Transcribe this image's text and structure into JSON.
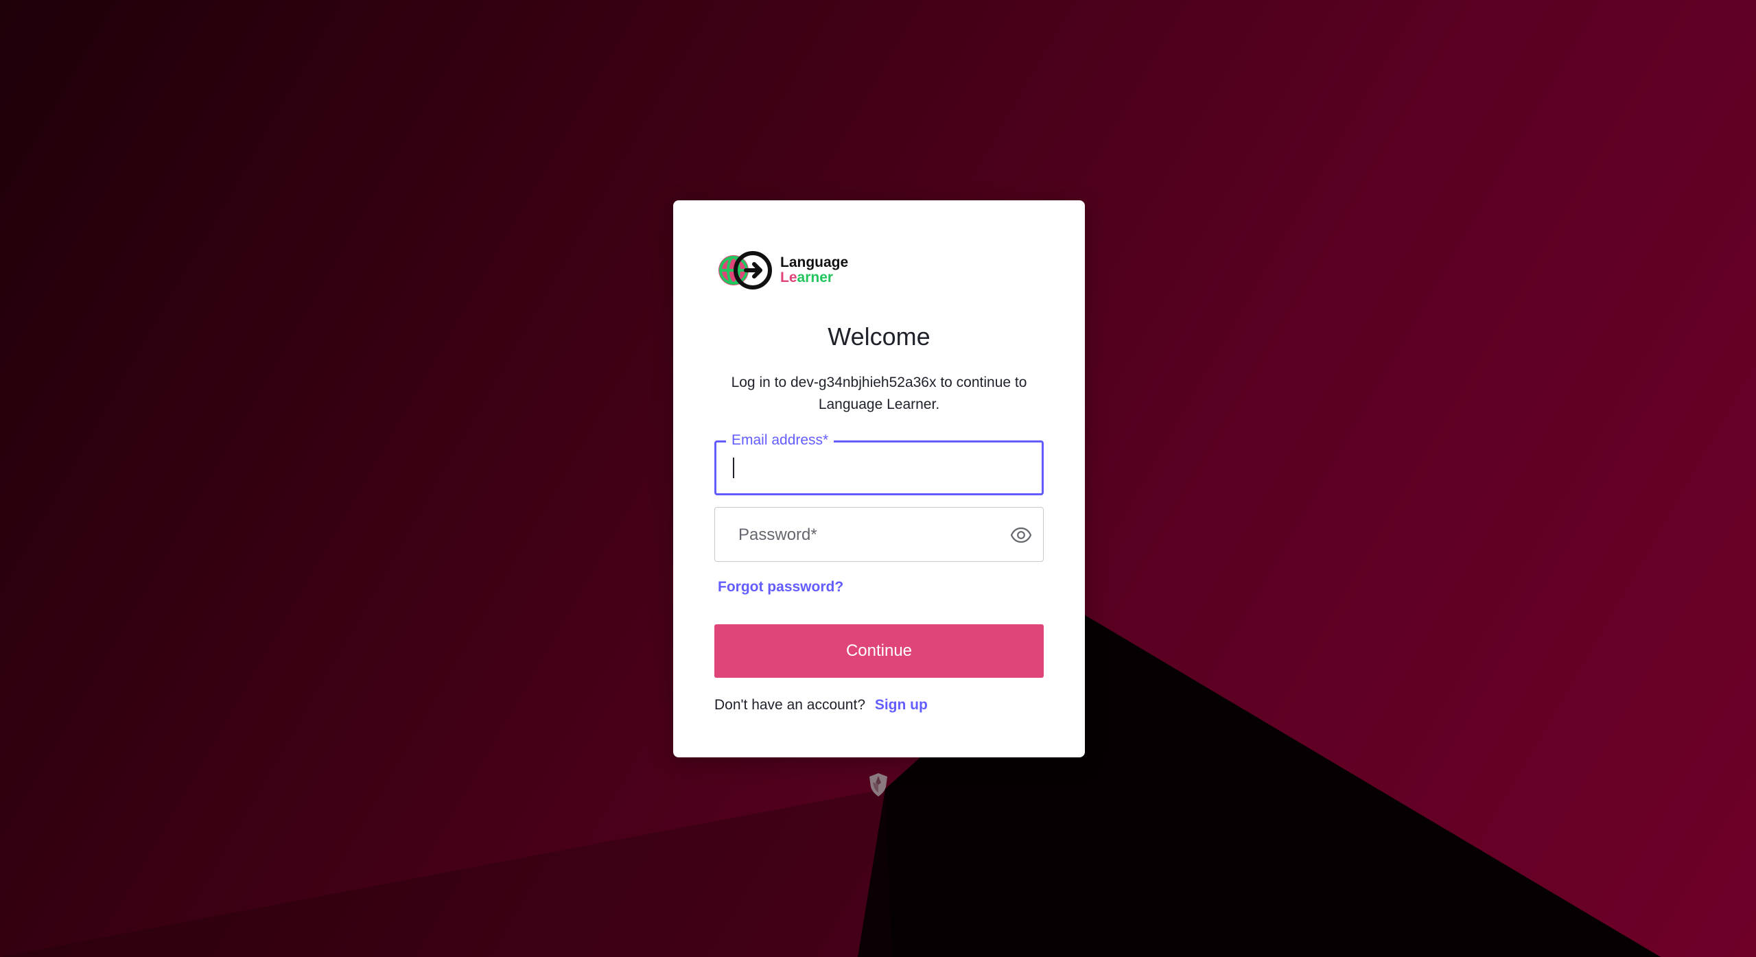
{
  "brand": {
    "line1": "Language",
    "line2_prefix": "Le",
    "line2_rest": "arner",
    "colors": {
      "pink": "#e0457a",
      "green": "#22c55e",
      "dark": "#111111"
    }
  },
  "login": {
    "title": "Welcome",
    "subtitle": "Log in to dev-g34nbjhieh52a36x to continue to Language Learner.",
    "email": {
      "label": "Email address*",
      "value": ""
    },
    "password": {
      "placeholder": "Password*",
      "value": "",
      "toggle_icon": "eye-icon"
    },
    "forgot_password": "Forgot password?",
    "continue_label": "Continue",
    "no_account_text": "Don't have an account?",
    "signup_label": "Sign up"
  },
  "footer": {
    "icon": "auth0-shield-icon"
  },
  "theme": {
    "accent": "#635dff",
    "button": "#e0457a",
    "background_dark": "#1e0009",
    "background_light": "#6e0028"
  }
}
